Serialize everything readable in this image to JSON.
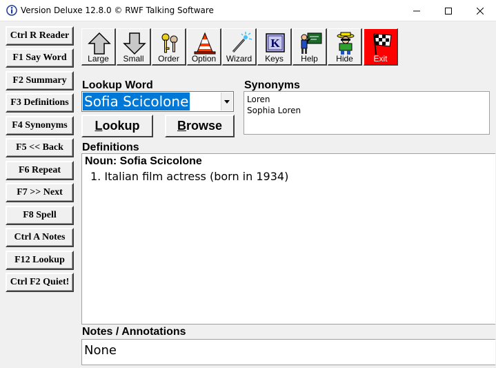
{
  "window": {
    "title": "Version Deluxe 12.8.0 © RWF Talking Software",
    "minimize": "—",
    "maximize": "☐",
    "close": "✕"
  },
  "keys": [
    "Ctrl R Reader",
    "F1 Say Word",
    "F2 Summary",
    "F3 Definitions",
    "F4 Synonyms",
    "F5 << Back",
    "F6 Repeat",
    "F7 >> Next",
    "F8 Spell",
    "Ctrl A Notes",
    "F12 Lookup",
    "Ctrl F2 Quiet!"
  ],
  "toolbar": {
    "large": "Large",
    "small": "Small",
    "order": "Order",
    "option": "Option",
    "wizard": "Wizard",
    "keys": "Keys",
    "help": "Help",
    "hide": "Hide",
    "exit": "Exit",
    "exit_color": "#ff0000"
  },
  "lookup": {
    "label": "Lookup Word",
    "value": "Sofia Scicolone",
    "lookup_button_first": "L",
    "lookup_button_rest": "ookup",
    "browse_button_first": "B",
    "browse_button_rest": "rowse",
    "selection_color": "#0078d7"
  },
  "synonyms": {
    "label": "Synonyms",
    "items": [
      "Loren",
      "Sophia Loren"
    ]
  },
  "definitions": {
    "label": "Definitions",
    "heading": "Noun: Sofia Scicolone",
    "items": [
      "1.  Italian film actress (born in 1934)"
    ]
  },
  "notes": {
    "label": "Notes / Annotations",
    "value": "None"
  }
}
